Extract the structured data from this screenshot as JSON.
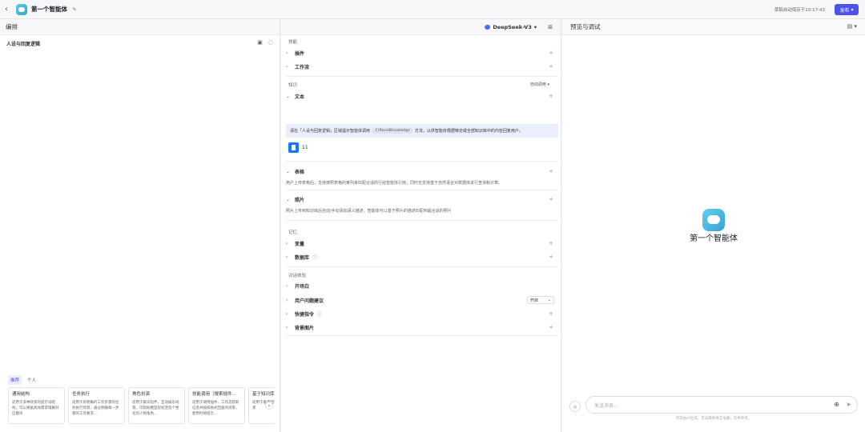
{
  "topbar": {
    "agent_name": "第一个智能体",
    "saved_text": "草稿自动保存于10:17:43",
    "publish_label": "发布"
  },
  "left": {
    "header": "编排",
    "prompt_title": "人设与回复逻辑",
    "template_tabs": [
      "推荐",
      "个人"
    ],
    "templates": [
      {
        "title": "通用结构",
        "desc": "适用于多种场景的提示词结构，可以根据具体需求增删对应模块"
      },
      {
        "title": "任务执行",
        "desc": "适用于有明确的工作步骤的任务执行场景，通过明确每一步骤的工作要求..."
      },
      {
        "title": "角色扮演",
        "desc": "适用于聊天陪伴、互动娱乐场景，可帮助模型轻松塑造个性化的人物角色..."
      },
      {
        "title": "技能调用（搜索插件...",
        "desc": "适用于调用插件、工作流获取信息并按照格式回复的场景，使用时将提示..."
      },
      {
        "title": "基于知识库...",
        "desc": "适用于着重回答用户问题的场景"
      }
    ]
  },
  "mid": {
    "model_name": "DeepSeek-V3",
    "skills_label": "技能",
    "plugin": "插件",
    "workflow": "工作流",
    "knowledge_label": "知识",
    "auto_call": "自动调用",
    "text": "文本",
    "hint_before": "请在「人设与回复逻辑」区域提示智能体调用",
    "hint_code": "{}RecallKnowledge",
    "hint_after": "方法，以供智能体根据特定或全部知识库中的内容回复用户。",
    "kb_name": "11",
    "table": "表格",
    "table_desc": "用户上传表格后，支持按照表格的某列来匹配合适的行给智能体引用，同时也支持基于自然语言对数据库进行查询和计算。",
    "photo": "照片",
    "photo_desc": "照片上传到知识库后自动/手动添加语义描述，智能体可以基于照片的描述匹配到最合适的照片",
    "memory_label": "记忆",
    "variable": "变量",
    "database": "数据库",
    "dialog_label": "对话体验",
    "opening": "开场白",
    "suggestion": "用户问题建议",
    "suggestion_value": "开启",
    "shortcut": "快捷指令",
    "background": "背景图片"
  },
  "right": {
    "header": "预览与调试",
    "agent_name": "第一个智能体",
    "input_placeholder": "发送消息...",
    "disclaimer": "内容由AI生成，无法确保真实准确，仅供参考。"
  }
}
